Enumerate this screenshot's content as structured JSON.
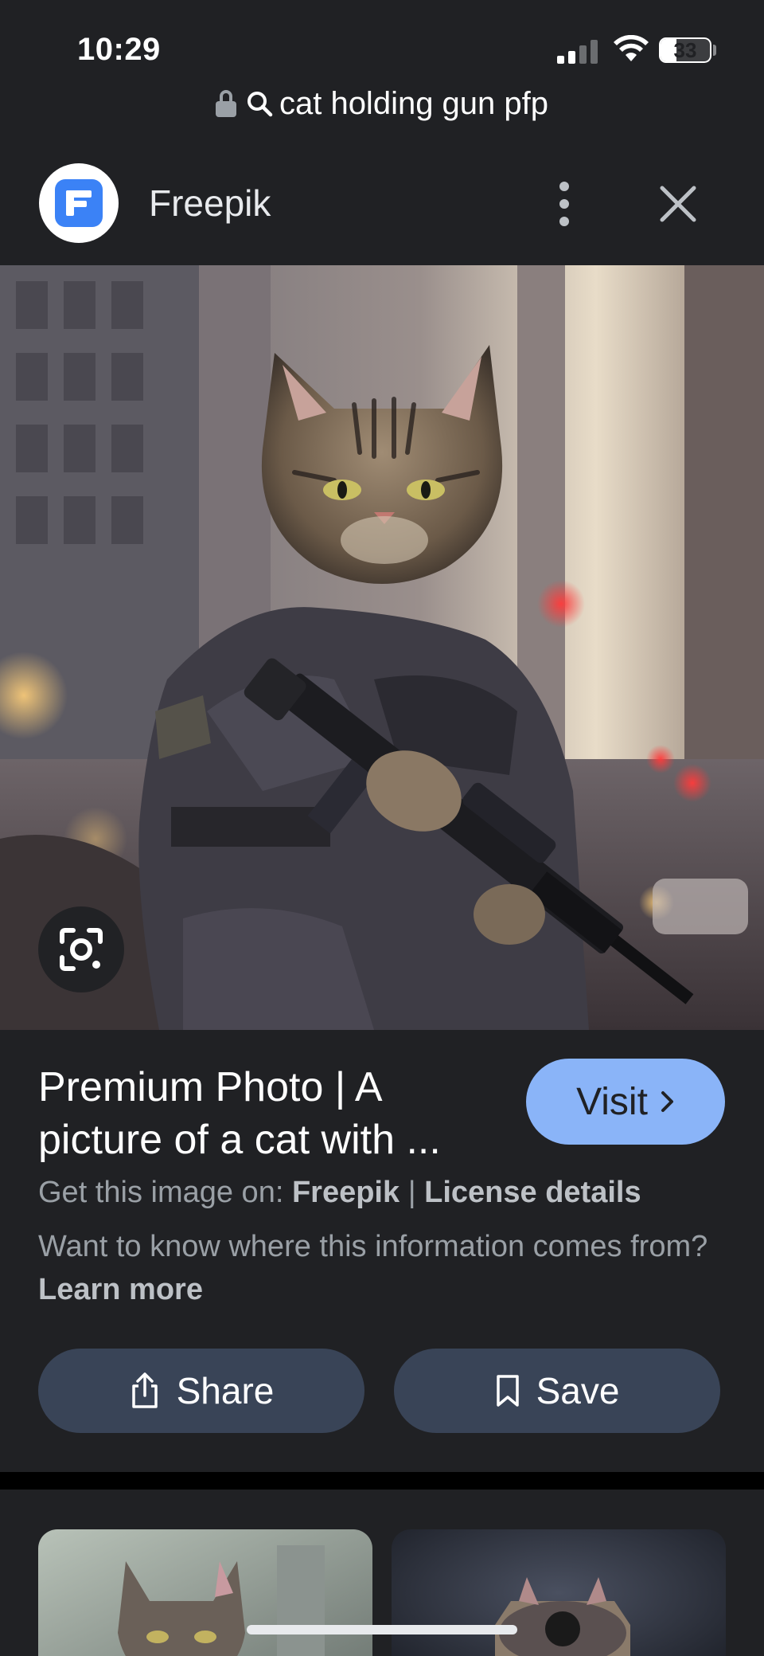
{
  "status_bar": {
    "time": "10:29",
    "battery": "33",
    "battery_level": 0.33,
    "signal_bars": 2
  },
  "url_bar": {
    "query": "cat holding gun pfp"
  },
  "header": {
    "site_name": "Freepik"
  },
  "result": {
    "title": "Premium Photo | A picture of a cat with ...",
    "visit_label": "Visit",
    "source_prefix": "Get this image on:",
    "source_name": "Freepik",
    "separator": "|",
    "license_label": "License details",
    "info_prefix": "Want to know where this information comes from?",
    "learn_more": "Learn more"
  },
  "actions": {
    "share_label": "Share",
    "save_label": "Save"
  },
  "icons": [
    "lock-icon",
    "search-icon",
    "freepik-logo",
    "more-vert-icon",
    "close-icon",
    "lens-icon",
    "share-icon",
    "bookmark-icon",
    "chevron-right-icon"
  ],
  "colors": {
    "background": "#202124",
    "accent": "#8ab4f8",
    "action_button": "#394457"
  }
}
